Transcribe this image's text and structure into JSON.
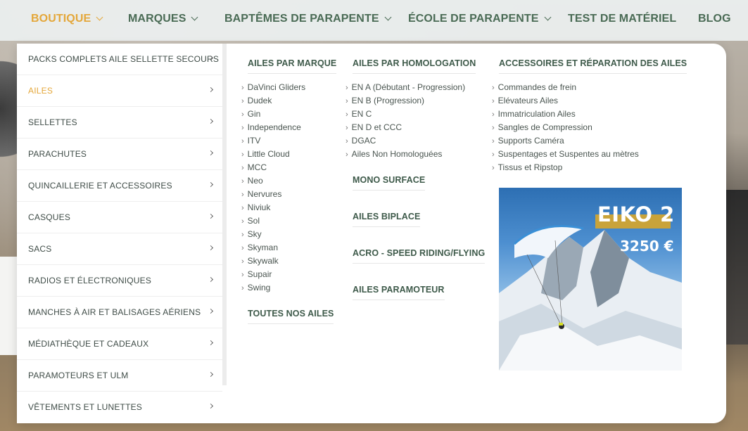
{
  "topnav": {
    "items": [
      {
        "label": "BOUTIQUE",
        "active": true,
        "has_dropdown": true
      },
      {
        "label": "MARQUES",
        "has_dropdown": true
      },
      {
        "label": "BAPTÊMES DE PARAPENTE",
        "has_dropdown": true
      },
      {
        "label": "ÉCOLE DE PARAPENTE",
        "has_dropdown": true
      },
      {
        "label": "TEST DE MATÉRIEL",
        "has_dropdown": false
      },
      {
        "label": "BLOG",
        "has_dropdown": false
      }
    ]
  },
  "categories": [
    {
      "label": "PACKS COMPLETS AILE SELLETTE SECOURS"
    },
    {
      "label": "AILES",
      "active": true
    },
    {
      "label": "SELLETTES"
    },
    {
      "label": "PARACHUTES"
    },
    {
      "label": "QUINCAILLERIE ET ACCESSOIRES"
    },
    {
      "label": "CASQUES"
    },
    {
      "label": "SACS"
    },
    {
      "label": "RADIOS ET ÉLECTRONIQUES"
    },
    {
      "label": "MANCHES À AIR ET BALISAGES AÉRIENS"
    },
    {
      "label": "MÉDIATHÈQUE ET CADEAUX"
    },
    {
      "label": "PARAMOTEURS ET ULM"
    },
    {
      "label": "VÊTEMENTS ET LUNETTES"
    }
  ],
  "col_brand": {
    "title": "AILES PAR MARQUE",
    "items": [
      "DaVinci Gliders",
      "Dudek",
      "Gin",
      "Independence",
      "ITV",
      "Little Cloud",
      "MCC",
      "Neo",
      "Nervures",
      "Niviuk",
      "Sol",
      "Sky",
      "Skyman",
      "Skywalk",
      "Supair",
      "Swing"
    ],
    "footer_title": "TOUTES NOS AILES"
  },
  "col_homolog": {
    "title": "AILES PAR HOMOLOGATION",
    "items": [
      "EN A (Débutant - Progression)",
      "EN B (Progression)",
      "EN C",
      "EN D et CCC",
      "DGAC",
      "Ailes Non Homologuées"
    ],
    "links": [
      "MONO SURFACE",
      "AILES BIPLACE",
      "ACRO - SPEED RIDING/FLYING",
      "AILES PARAMOTEUR"
    ]
  },
  "col_accessories": {
    "title": "ACCESSOIRES ET RÉPARATION DES AILES",
    "items": [
      "Commandes de frein",
      "Elévateurs Ailes",
      "Immatriculation Ailes",
      "Sangles de Compression",
      "Supports Caméra",
      "Suspentages et Suspentes au mètres",
      "Tissus et Ripstop"
    ]
  },
  "promo": {
    "title": "EIKO 2",
    "price": "3250 €",
    "colors": {
      "band": "#c9a33a",
      "sky": "#2d6fb3"
    }
  },
  "colors": {
    "nav_text": "#4a6b55",
    "active": "#e4a73a",
    "menu_bg": "#ffffff"
  }
}
